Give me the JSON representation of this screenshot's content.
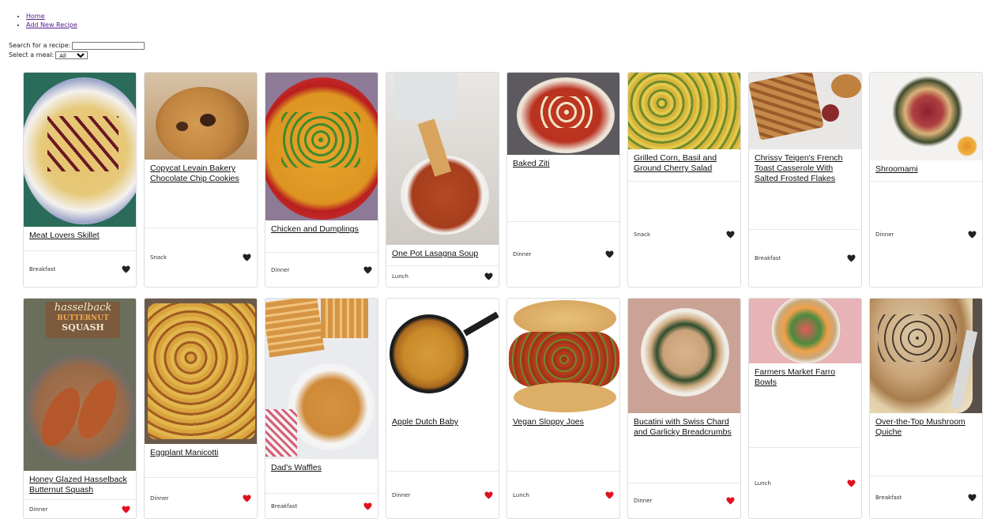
{
  "nav": {
    "home": "Home",
    "add": "Add New Recipe"
  },
  "search": {
    "label": "Search for a recipe:",
    "value": "",
    "meal_label": "Select a meal:",
    "meal_value": "All"
  },
  "recipes": [
    {
      "title": "Meat Lovers Skillet",
      "meal": "Breakfast",
      "favorite": false
    },
    {
      "title": "Copycat Levain Bakery Chocolate Chip Cookies",
      "meal": "Snack",
      "favorite": false
    },
    {
      "title": "Chicken and Dumplings",
      "meal": "Dinner",
      "favorite": false
    },
    {
      "title": "One Pot Lasagna Soup",
      "meal": "Lunch",
      "favorite": false
    },
    {
      "title": "Baked Ziti",
      "meal": "Dinner",
      "favorite": false
    },
    {
      "title": "Grilled Corn, Basil and Ground Cherry Salad",
      "meal": "Snack",
      "favorite": false
    },
    {
      "title": "Chrissy Teigen's French Toast Casserole With Salted Frosted Flakes",
      "meal": "Breakfast",
      "favorite": false
    },
    {
      "title": "Shroomami",
      "meal": "Dinner",
      "favorite": false
    },
    {
      "title": "Honey Glazed Hasselback Butternut Squash",
      "meal": "Dinner",
      "favorite": true,
      "image_text": [
        "hasselback",
        "BUTTERNUT",
        "SQUASH"
      ]
    },
    {
      "title": "Eggplant Manicotti",
      "meal": "Dinner",
      "favorite": true
    },
    {
      "title": "Dad's Waffles",
      "meal": "Breakfast",
      "favorite": true
    },
    {
      "title": "Apple Dutch Baby",
      "meal": "Dinner",
      "favorite": true
    },
    {
      "title": "Vegan Sloppy Joes",
      "meal": "Lunch",
      "favorite": true
    },
    {
      "title": "Bucatini with Swiss Chard and Garlicky Breadcrumbs",
      "meal": "Dinner",
      "favorite": true
    },
    {
      "title": "Farmers Market Farro Bowls",
      "meal": "Lunch",
      "favorite": true
    },
    {
      "title": "Over-the-Top Mushroom Quiche",
      "meal": "Breakfast",
      "favorite": false
    }
  ],
  "colors": {
    "heart_off": "#222222",
    "heart_on": "#e0101e",
    "link": "#551a8b"
  }
}
